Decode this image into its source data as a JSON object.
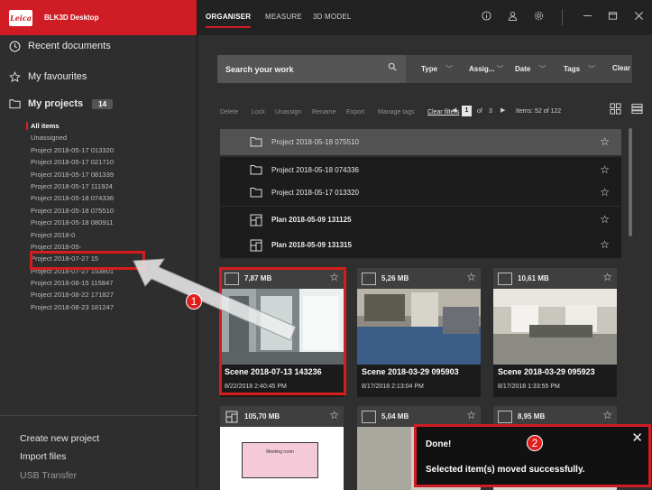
{
  "app": {
    "logo": "Leica",
    "title": "BLK3D Desktop"
  },
  "sidebar": {
    "recent": "Recent documents",
    "favourites": "My favourites",
    "projects_label": "My projects",
    "projects_count": "14",
    "items": [
      {
        "label": "All items",
        "active": true
      },
      {
        "label": "Unassigned"
      },
      {
        "label": "Project 2018-05-17 013320"
      },
      {
        "label": "Project 2018-05-17 021710"
      },
      {
        "label": "Project 2018-05-17 081339"
      },
      {
        "label": "Project 2018-05-17 111924"
      },
      {
        "label": "Project 2018-05-18 074336"
      },
      {
        "label": "Project 2018-05-18 075510"
      },
      {
        "label": "Project 2018-05-18 080911"
      },
      {
        "label": "Project 2018-0"
      },
      {
        "label": "Project 2018-05-"
      },
      {
        "label": "Project 2018-07-27 15"
      },
      {
        "label": "Project 2018-07-27 153801"
      },
      {
        "label": "Project 2018-08-15 115847"
      },
      {
        "label": "Project 2018-08-22 171827"
      },
      {
        "label": "Project 2018-08-23 181247"
      }
    ],
    "create": "Create new project",
    "import": "Import files",
    "usb": "USB Transfer"
  },
  "tabs": [
    {
      "label": "ORGANISER",
      "active": true
    },
    {
      "label": "MEASURE"
    },
    {
      "label": "3D MODEL"
    }
  ],
  "search": {
    "placeholder": "Search your work"
  },
  "filters": {
    "type": "Type",
    "assign": "Assig...",
    "date": "Date",
    "tags": "Tags",
    "clear": "Clear"
  },
  "toolbar": {
    "delete": "Delete",
    "lock": "Lock",
    "unassign": "Unassign",
    "rename": "Rename",
    "export": "Export",
    "manage_tags": "Manage tags",
    "clear_filters": "Clear filters",
    "page": "1",
    "of": "of",
    "total_pages": "3",
    "items": "Items: 52 of 122"
  },
  "rows": [
    {
      "label": "Project 2018-05-18 075510",
      "kind": "folder",
      "selected": true
    },
    {
      "label": "Project 2018-05-18 074336",
      "kind": "folder"
    },
    {
      "label": "Project 2018-05-17 013320",
      "kind": "folder"
    },
    {
      "label": "Plan 2018-05-09 131125",
      "kind": "plan"
    },
    {
      "label": "Plan 2018-05-09 131315",
      "kind": "plan"
    }
  ],
  "cards": [
    {
      "size": "7,87 MB",
      "title": "Scene 2018-07-13 143236",
      "date": "8/22/2018 2:40:45 PM"
    },
    {
      "size": "5,26 MB",
      "title": "Scene 2018-03-29 095903",
      "date": "8/17/2018 2:13:04 PM"
    },
    {
      "size": "10,61 MB",
      "title": "Scene 2018-03-29 095923",
      "date": "8/17/2018 1:33:55 PM"
    },
    {
      "size": "105,70 MB",
      "thumb_text": "Meeting room"
    },
    {
      "size": "5,04 MB"
    },
    {
      "size": "8,95 MB"
    }
  ],
  "toast": {
    "title": "Done!",
    "message": "Selected item(s) moved successfully."
  },
  "annotations": {
    "one": "1",
    "two": "2"
  },
  "colors": {
    "accent": "#d01c24",
    "highlight": "#d61c1c"
  }
}
